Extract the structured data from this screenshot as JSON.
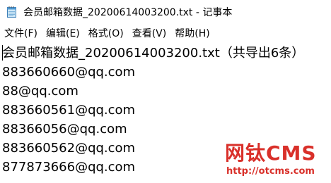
{
  "window": {
    "title": "会员邮箱数据_20200614003200.txt - 记事本",
    "icon": "notepad-icon"
  },
  "menu": [
    {
      "label": "文件(F)"
    },
    {
      "label": "编辑(E)"
    },
    {
      "label": "格式(O)"
    },
    {
      "label": "查看(V)"
    },
    {
      "label": "帮助(H)"
    }
  ],
  "document": {
    "lines": [
      "会员邮箱数据_20200614003200.txt（共导出6条）",
      "883660660@qq.com",
      "88@qq.com",
      "883660561@qq.com",
      "88366056@qq.com",
      "883660562@qq.com",
      "877873666@qq.com"
    ]
  },
  "watermark": {
    "brand": "网钛CMS",
    "url": "http://otcms.com",
    "color": "#d9302a"
  }
}
